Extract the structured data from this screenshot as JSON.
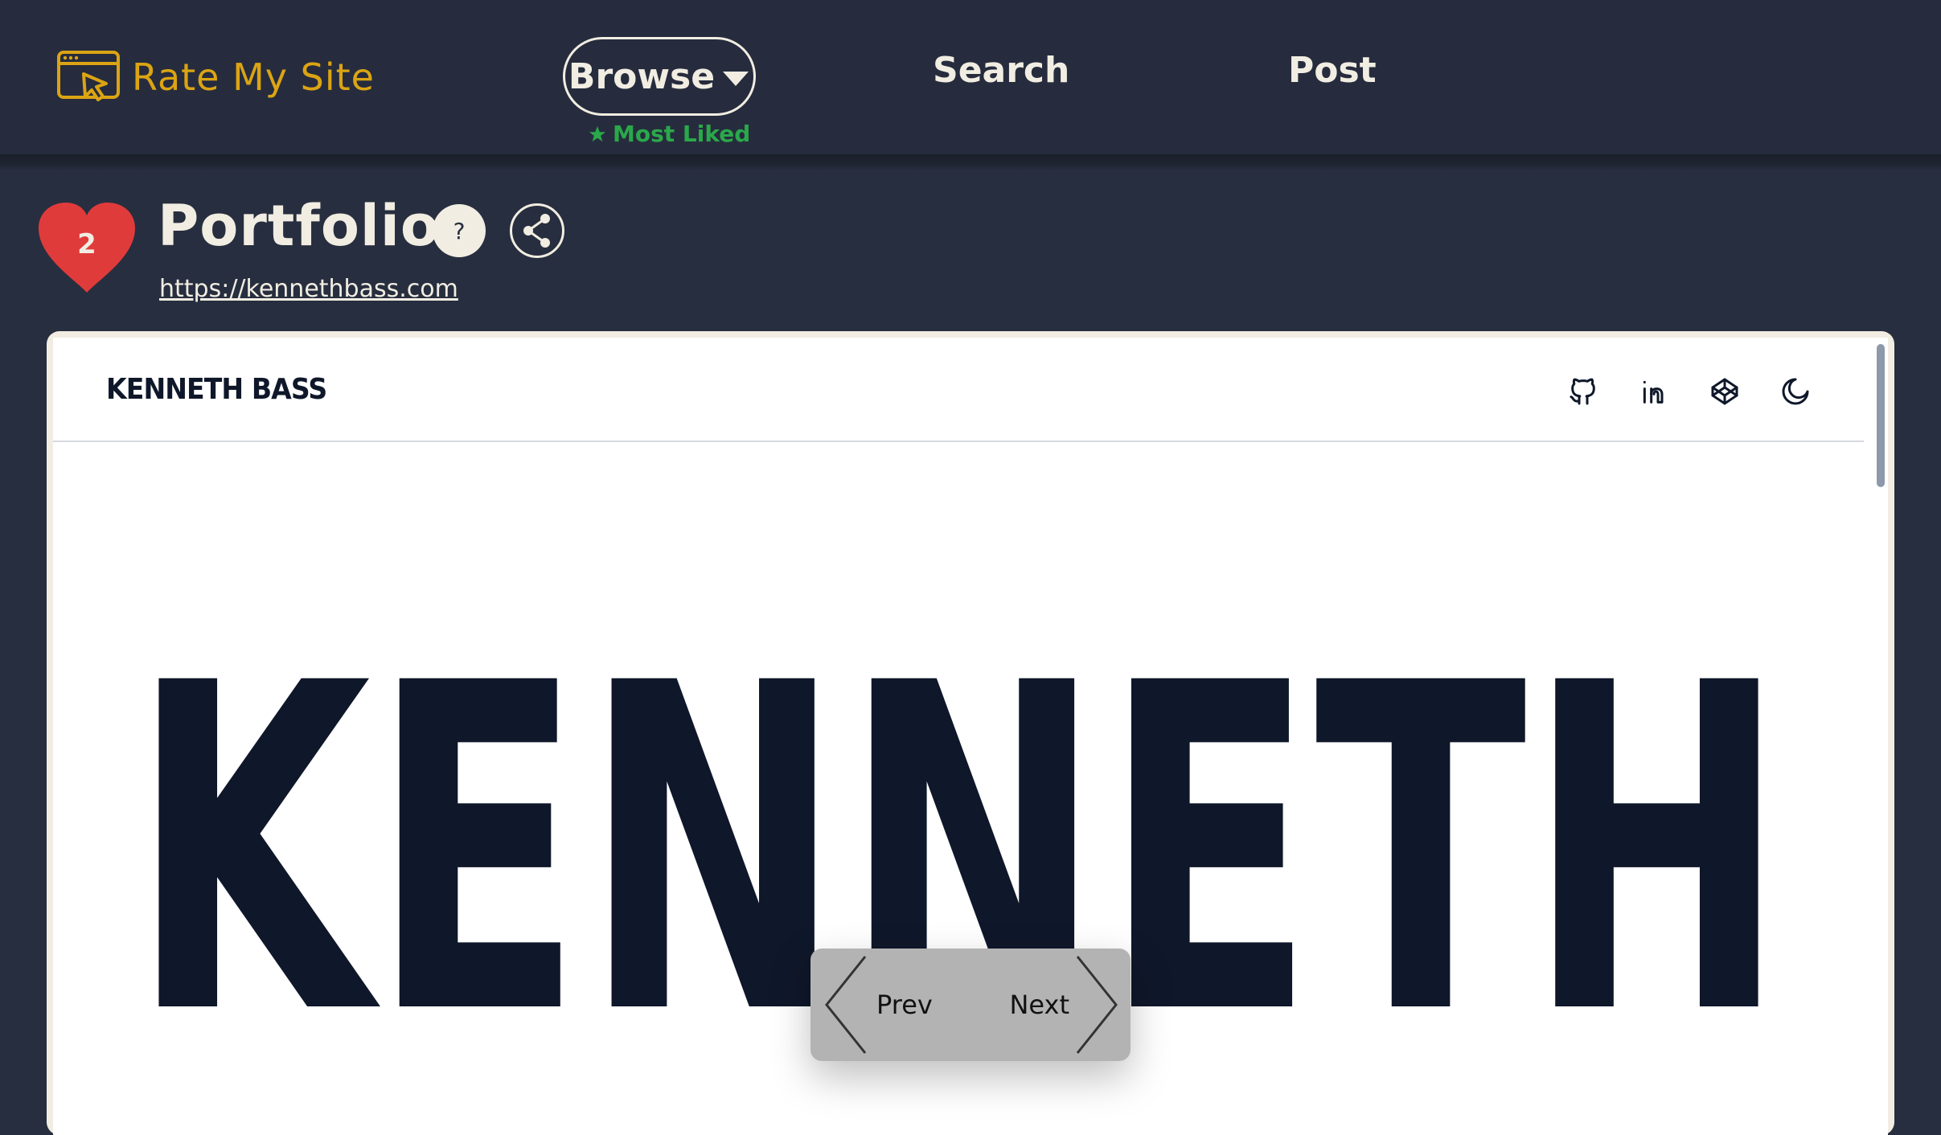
{
  "app": {
    "logo_text": "Rate My Site",
    "brand_color": "#dba413"
  },
  "nav": {
    "browse_label": "Browse",
    "browse_sublabel": "Most Liked",
    "search_label": "Search",
    "post_label": "Post"
  },
  "site": {
    "likes": "2",
    "title": "Portfolio",
    "help_label": "?",
    "url": "https://kennethbass.com"
  },
  "preview": {
    "brand": "KENNETH BASS",
    "hero_text": "KENNETH",
    "header_icons": [
      "github-icon",
      "linkedin-icon",
      "codepen-icon",
      "moon-icon"
    ]
  },
  "pager": {
    "prev_label": "Prev",
    "next_label": "Next"
  },
  "colors": {
    "background": "#272e3f",
    "text": "#f1ede2",
    "heart": "#e03b3b",
    "most_liked": "#2aa84a",
    "hero_text": "#0f172a"
  }
}
